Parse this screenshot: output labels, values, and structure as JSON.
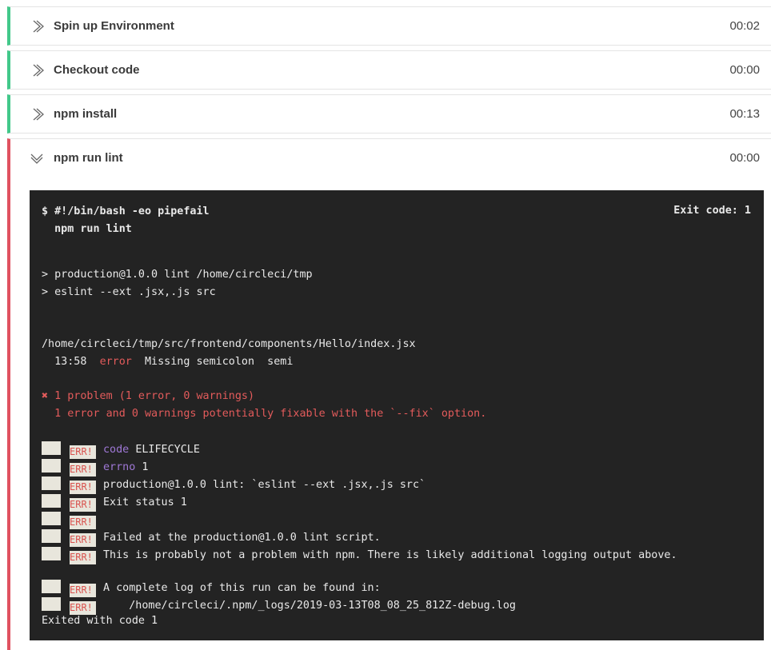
{
  "steps": [
    {
      "name": "Spin up Environment",
      "time": "00:02"
    },
    {
      "name": "Checkout code",
      "time": "00:00"
    },
    {
      "name": "npm install",
      "time": "00:13"
    },
    {
      "name": "npm run lint",
      "time": "00:00"
    }
  ],
  "colors": {
    "success": "#42c88a",
    "failed": "#e05260",
    "terminal_bg": "#232323"
  },
  "terminal": {
    "cmd_line1": "$ #!/bin/bash -eo pipefail",
    "cmd_line2": "  npm run lint",
    "exit_code": "Exit code: 1",
    "run_line1": "> production@1.0.0 lint /home/circleci/tmp",
    "run_line2": "> eslint --ext .jsx,.js src",
    "file_path": "/home/circleci/tmp/src/frontend/components/Hello/index.jsx",
    "lint_pos": "  13:58",
    "lint_level": "error",
    "lint_msg": "Missing semicolon  semi",
    "problem_icon": "✖",
    "problem_summary": "1 problem (1 error, 0 warnings)",
    "fixable_note": "  1 error and 0 warnings potentially fixable with the `--fix` option.",
    "err_tag": "ERR!",
    "err_lines": [
      {
        "key": "code",
        "text": "ELIFECYCLE"
      },
      {
        "key": "errno",
        "text": "1"
      },
      {
        "key": "",
        "text": "production@1.0.0 lint: `eslint --ext .jsx,.js src`"
      },
      {
        "key": "",
        "text": "Exit status 1"
      },
      {
        "key": "",
        "text": ""
      },
      {
        "key": "",
        "text": "Failed at the production@1.0.0 lint script."
      },
      {
        "key": "",
        "text": "This is probably not a problem with npm. There is likely additional logging output above."
      }
    ],
    "log_lines": [
      {
        "text": "A complete log of this run can be found in:"
      },
      {
        "text": "    /home/circleci/.npm/_logs/2019-03-13T08_08_25_812Z-debug.log"
      }
    ],
    "final_line": "Exited with code 1"
  }
}
